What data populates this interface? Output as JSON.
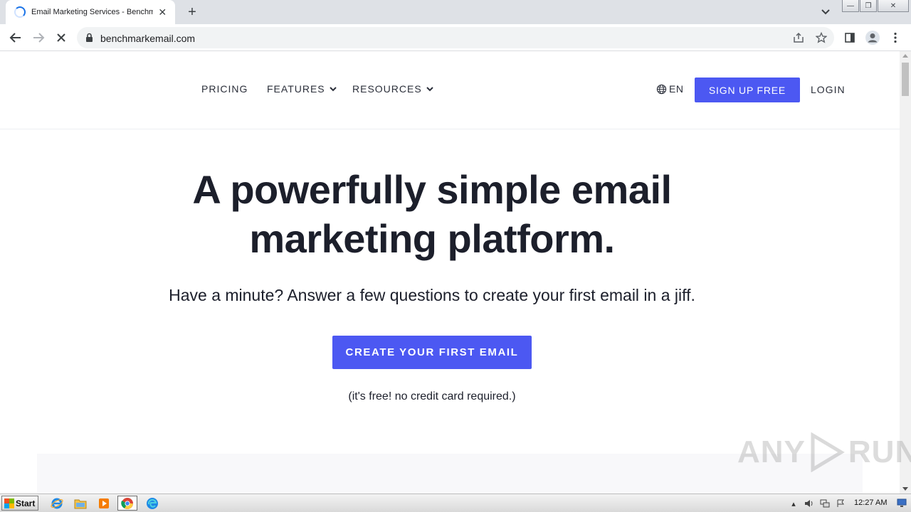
{
  "browser": {
    "tab": {
      "title": "Email Marketing Services - Benchmark Email"
    },
    "newtab_symbol": "+",
    "close_symbol": "✕",
    "address": {
      "url": "benchmarkemail.com"
    },
    "window_controls": {
      "minimize": "—",
      "restore": "❐",
      "close": "✕"
    }
  },
  "site": {
    "nav": {
      "pricing": "PRICING",
      "features": "FEATURES",
      "resources": "RESOURCES",
      "language": "EN",
      "signup": "SIGN UP FREE",
      "login": "LOGIN"
    },
    "hero": {
      "title_line1": "A powerfully simple email",
      "title_line2": "marketing platform.",
      "subtitle": "Have a minute? Answer a few questions to create your first email in a jiff.",
      "cta": "CREATE YOUR FIRST EMAIL",
      "note": "(it's free! no credit card required.)"
    },
    "accent_color": "#4c58f2",
    "text_color": "#1c1f2b"
  },
  "watermark": {
    "left": "ANY",
    "right": "RUN"
  },
  "taskbar": {
    "start": "Start",
    "clock": "12:27 AM",
    "apps": [
      "ie-icon",
      "explorer-icon",
      "media-player-icon",
      "chrome-icon",
      "edge-icon"
    ]
  }
}
